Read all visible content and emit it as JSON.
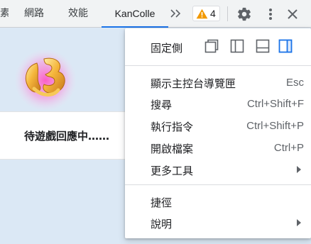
{
  "toolbar": {
    "tabs": [
      {
        "label": "素"
      },
      {
        "label": "網路"
      },
      {
        "label": "效能"
      },
      {
        "label": "KanColle"
      }
    ],
    "more_tabs_icon": "double-chevron-right-icon",
    "warning_count": "4",
    "warning_color": "#f29900",
    "accent_color": "#1a73e8"
  },
  "page": {
    "loading_text": "待遊戲回應中……"
  },
  "menu": {
    "dock_label": "固定側",
    "dock_options": [
      {
        "name": "undock-into-window",
        "selected": false
      },
      {
        "name": "dock-left",
        "selected": false
      },
      {
        "name": "dock-bottom",
        "selected": false
      },
      {
        "name": "dock-right",
        "selected": true
      }
    ],
    "items": [
      {
        "label": "顯示主控台導覽匣",
        "shortcut": "Esc"
      },
      {
        "label": "搜尋",
        "shortcut": "Ctrl+Shift+F"
      },
      {
        "label": "執行指令",
        "shortcut": "Ctrl+Shift+P"
      },
      {
        "label": "開啟檔案",
        "shortcut": "Ctrl+P"
      },
      {
        "label": "更多工具",
        "shortcut": ""
      },
      {
        "label": "捷徑",
        "shortcut": ""
      },
      {
        "label": "說明",
        "shortcut": ""
      }
    ]
  }
}
